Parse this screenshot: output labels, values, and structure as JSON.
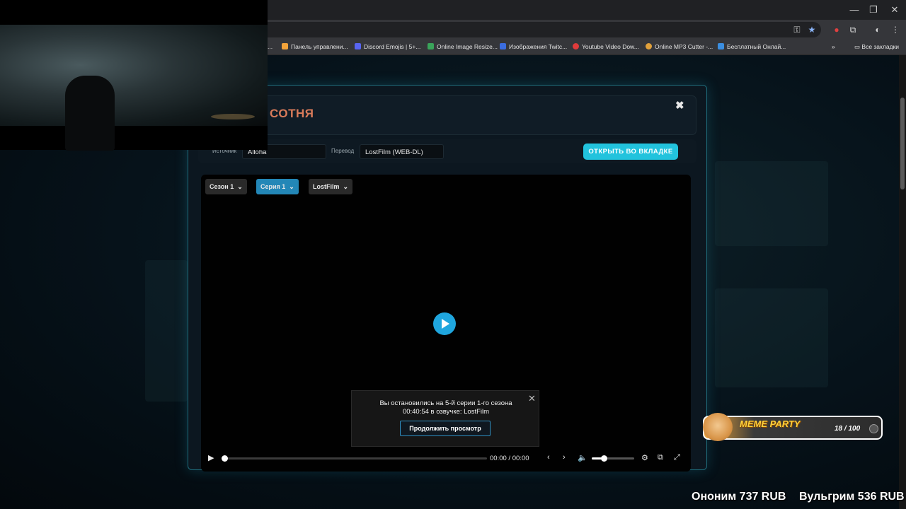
{
  "browser": {
    "window_controls": [
      "—",
      "❐",
      "✕"
    ],
    "bookmarks": [
      {
        "label": "...",
        "color": "#555555"
      },
      {
        "label": "Панель управлени...",
        "color": "#f2a33a"
      },
      {
        "label": "Discord Emojis | 5+...",
        "color": "#5865f2"
      },
      {
        "label": "Online Image Resize...",
        "color": "#3aa35a"
      },
      {
        "label": "Изображения Twitc...",
        "color": "#3b6de0"
      },
      {
        "label": "Youtube Video Dow...",
        "color": "#e03b3b"
      },
      {
        "label": "Online MP3 Cutter -...",
        "color": "#e0a03b"
      },
      {
        "label": "Бесплатный Онлай...",
        "color": "#3b8ee0"
      }
    ],
    "all_bookmarks": "Все закладки"
  },
  "modal": {
    "title": "ТЬ: СОТНЯ",
    "source_label": "Источник",
    "source_value": "Alloha",
    "translation_label": "Перевод",
    "translation_value": "LostFilm (WEB-DL)",
    "open_tab_button": "ОТКРЫТЬ ВО ВКЛАДКЕ"
  },
  "player": {
    "season": "Сезон 1",
    "episode": "Серия 1",
    "voice": "LostFilm",
    "resume_line1": "Вы остановились на 5-й серии 1-го сезона",
    "resume_line2": "00:40:54 в озвучке: LostFilm",
    "resume_button": "Продолжить просмотр",
    "time_current": "00:00",
    "time_separator": "/",
    "time_total": "00:00",
    "progress": 0,
    "volume": 0.3
  },
  "widget": {
    "title": "MEME PARTY",
    "count": "18 / 100"
  },
  "donations": [
    {
      "text": "Ононим 737 RUB"
    },
    {
      "text": "Вульгрим 536 RUB"
    }
  ]
}
